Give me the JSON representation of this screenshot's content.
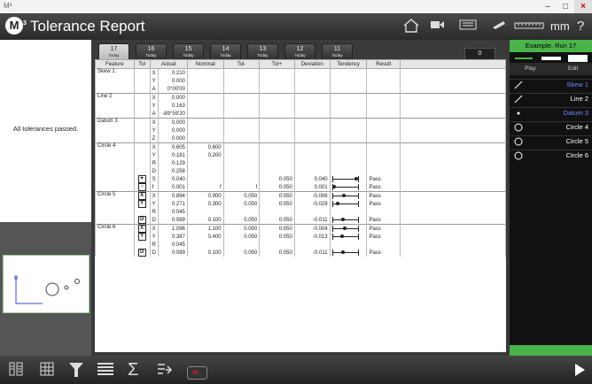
{
  "window": {
    "app_tag": "M³",
    "minimize": "–",
    "maximize": "□",
    "close": "×"
  },
  "header": {
    "logo_letter": "M",
    "logo_sup": "3",
    "title": "Tolerance Report",
    "units": "mm",
    "help": "?"
  },
  "left": {
    "status": "All tolerances passed."
  },
  "tabs": [
    {
      "num": "17",
      "day": "Today",
      "active": true
    },
    {
      "num": "16",
      "day": "Today"
    },
    {
      "num": "15",
      "day": "Today"
    },
    {
      "num": "14",
      "day": "Today"
    },
    {
      "num": "13",
      "day": "Today"
    },
    {
      "num": "12",
      "day": "Today"
    },
    {
      "num": "11",
      "day": "Today"
    }
  ],
  "count": "0",
  "columns": [
    "Feature",
    "Tol",
    "Actual",
    "",
    "Nominal",
    "Tol-",
    "Tol+",
    "Deviation",
    "Tendency",
    "Result"
  ],
  "rows": [
    {
      "feature": "Skew 1",
      "axis": "X",
      "actual": "0.210",
      "group_start": true
    },
    {
      "axis": "Y",
      "actual": "0.000"
    },
    {
      "axis": "A",
      "actual": "0°00'00"
    },
    {
      "feature": "Line 2",
      "axis": "X",
      "actual": "0.000",
      "group_start": true
    },
    {
      "axis": "Y",
      "actual": "0.163"
    },
    {
      "axis": "A",
      "actual": "-89°59'20"
    },
    {
      "feature": "Datum 3",
      "axis": "X",
      "actual": "0.000",
      "group_start": true
    },
    {
      "axis": "Y",
      "actual": "0.000"
    },
    {
      "axis": "Z",
      "actual": "0.000"
    },
    {
      "feature": "Circle 4",
      "axis": "X",
      "actual": "0.605",
      "nominal": "0.600",
      "group_start": true
    },
    {
      "axis": "Y",
      "actual": "0.181",
      "nominal": "0.200"
    },
    {
      "axis": "R",
      "actual": "0.129"
    },
    {
      "axis": "D",
      "actual": "0.258"
    },
    {
      "tol": "⌖",
      "axis": "S",
      "actual": "0.040",
      "tolplus": "0.050",
      "deviation": "0.040",
      "result": "Pass",
      "tend": 0.9
    },
    {
      "tol": "○",
      "axis": "f",
      "actual": "0.001",
      "nominal": "f",
      "tolminus": "f",
      "tolplus": "0.050",
      "deviation": "0.001",
      "result": "Pass",
      "tend": 0.06
    },
    {
      "feature": "Circle 5",
      "tol": "X",
      "axis": "X",
      "actual": "0.894",
      "nominal": "0.900",
      "tolminus": "0.050",
      "tolplus": "0.050",
      "deviation": "-0.006",
      "result": "Pass",
      "tend": 0.44,
      "group_start": true
    },
    {
      "tol": "Y",
      "axis": "Y",
      "actual": "0.271",
      "nominal": "0.300",
      "tolminus": "0.050",
      "tolplus": "0.050",
      "deviation": "-0.029",
      "result": "Pass",
      "tend": 0.21
    },
    {
      "axis": "R",
      "actual": "0.045"
    },
    {
      "tol": "D",
      "axis": "D",
      "actual": "0.089",
      "nominal": "0.100",
      "tolminus": "0.050",
      "tolplus": "0.050",
      "deviation": "-0.011",
      "result": "Pass",
      "tend": 0.39
    },
    {
      "feature": "Circle 6",
      "tol": "X",
      "axis": "X",
      "actual": "1.096",
      "nominal": "1.100",
      "tolminus": "0.050",
      "tolplus": "0.050",
      "deviation": "-0.004",
      "result": "Pass",
      "tend": 0.46,
      "group_start": true
    },
    {
      "tol": "Y",
      "axis": "Y",
      "actual": "0.387",
      "nominal": "0.400",
      "tolminus": "0.050",
      "tolplus": "0.050",
      "deviation": "-0.013",
      "result": "Pass",
      "tend": 0.37
    },
    {
      "axis": "R",
      "actual": "0.045"
    },
    {
      "tol": "D",
      "axis": "D",
      "actual": "0.089",
      "nominal": "0.100",
      "tolminus": "0.050",
      "tolplus": "0.050",
      "deviation": "-0.011",
      "result": "Pass",
      "tend": 0.39
    }
  ],
  "right": {
    "title": "Example, Run 17",
    "play": "Play",
    "edit": "Edit",
    "steps": [
      {
        "label": "Skew 1",
        "icon": "line-icon",
        "color": "#6b8cff"
      },
      {
        "label": "Line 2",
        "icon": "line-icon",
        "color": "#ffffff"
      },
      {
        "label": "Datum 3",
        "icon": "point-icon",
        "color": "#6b8cff"
      },
      {
        "label": "Circle 4",
        "icon": "circle-icon",
        "color": "#ffffff"
      },
      {
        "label": "Circle 5",
        "icon": "circle-icon",
        "color": "#ffffff"
      },
      {
        "label": "Circle 6",
        "icon": "circle-icon",
        "color": "#ffffff"
      }
    ]
  },
  "colors": {
    "accent_green": "#4ab34a",
    "highlight_blue": "#6b8cff"
  }
}
